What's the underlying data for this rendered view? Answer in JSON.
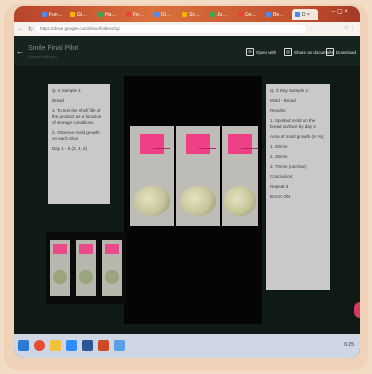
{
  "browser": {
    "tabs": [
      {
        "label": "Fun…",
        "color": "#4a8af4"
      },
      {
        "label": "Gi…",
        "color": "#f4b400"
      },
      {
        "label": "Ha…",
        "color": "#34a853"
      },
      {
        "label": "Fe…",
        "color": "#ea4335"
      },
      {
        "label": "Gi…",
        "color": "#4a8af4"
      },
      {
        "label": "Sc…",
        "color": "#f4b400"
      },
      {
        "label": "Ju…",
        "color": "#34a853"
      },
      {
        "label": "Ge…",
        "color": "#ea4335"
      },
      {
        "label": "Be…",
        "color": "#4a8af4"
      },
      {
        "label": "Fi…",
        "color": "#34a853"
      }
    ],
    "active_tab": {
      "label": "D ×",
      "color": "#4285f4"
    },
    "window_controls": "– ▢ ×",
    "url": "https://drive.google.com/drive/folders/1p"
  },
  "app": {
    "file_title": "Smile Final Pilot",
    "file_subtitle": "Shared with you",
    "buttons": {
      "open_with": "Open with",
      "share": "Share as document",
      "download": "Download"
    }
  },
  "panels": {
    "left": [
      "Q. 5 Sample 1:",
      "Bread",
      "1. To test the shelf life of the product as a function of storage conditions",
      "2. Observe mold growth on each slice",
      "Day 1 - 5 (3, 4, 5)"
    ],
    "right": [
      "Q. 3 Day Sample 1:",
      "Mold - Bread",
      "Results:",
      "1. Spotted mold on the bread surface by day 3",
      "Area of mold growth (in %):",
      "1. 40mm",
      "2. 25mm",
      "3. 70mm (unclear)",
      "Conclusion:",
      "Repeat 3",
      "BACK ON"
    ]
  },
  "taskbar": {
    "icons": [
      {
        "name": "windows-icon",
        "color": "#2a7ad6"
      },
      {
        "name": "chrome-icon",
        "color": "#e94a35"
      },
      {
        "name": "file-explorer-icon",
        "color": "#f0c23b"
      },
      {
        "name": "zoom-icon",
        "color": "#2d8cff"
      },
      {
        "name": "word-icon",
        "color": "#2b5797"
      },
      {
        "name": "powerpoint-icon",
        "color": "#d24726"
      },
      {
        "name": "photos-icon",
        "color": "#5aa0e6"
      }
    ],
    "time": "6:25"
  }
}
